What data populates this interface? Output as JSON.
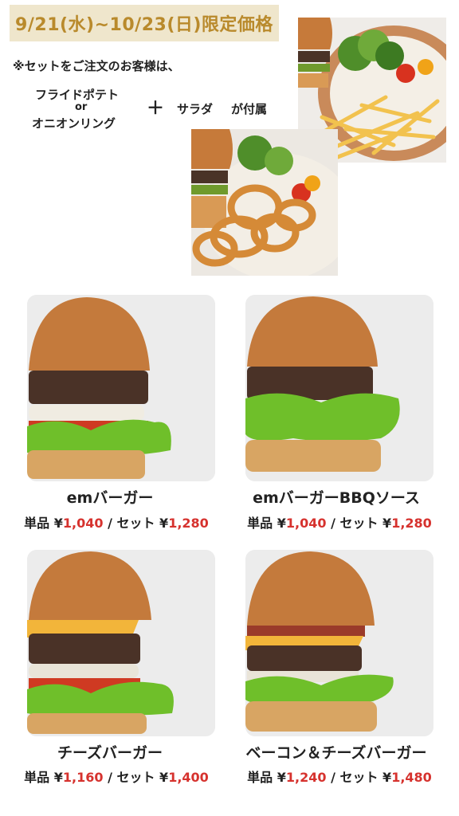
{
  "header": {
    "period_badge": "9/21(水)~10/23(日)限定価格",
    "set_note": "※セットをご注文のお客様は、",
    "option_fries": "フライドポテト",
    "option_or": "or",
    "option_rings": "オニオンリング",
    "plus": "＋",
    "option_salad": "サラダ",
    "attached": "が付属"
  },
  "labels": {
    "single": "単品 ¥",
    "set": " / セット ¥"
  },
  "products": [
    {
      "name": "emバーガー",
      "single_price": "1,040",
      "set_price": "1,280"
    },
    {
      "name": "emバーガーBBQソース",
      "single_price": "1,040",
      "set_price": "1,280"
    },
    {
      "name": "チーズバーガー",
      "single_price": "1,160",
      "set_price": "1,400"
    },
    {
      "name": "ベーコン＆チーズバーガー",
      "single_price": "1,240",
      "set_price": "1,480"
    }
  ],
  "colors": {
    "badge_bg": "#efe6cc",
    "badge_text": "#b98a2c",
    "price_red": "#d6322e"
  },
  "icons": [
    "fries-set-photo",
    "onion-rings-set-photo",
    "burger-photo"
  ]
}
